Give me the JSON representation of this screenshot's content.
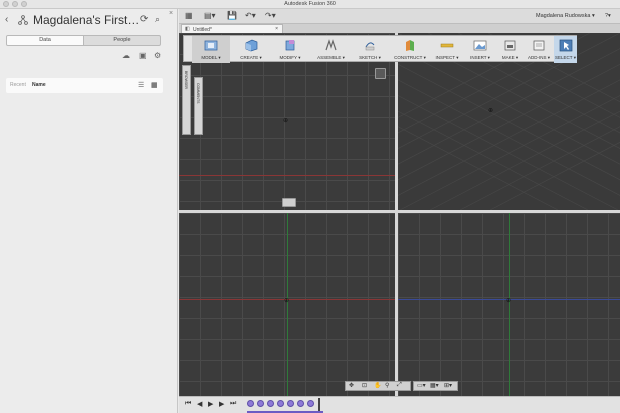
{
  "window": {
    "title": "Autodesk Fusion 360"
  },
  "data_panel": {
    "project_title": "Magdalena's First…",
    "tabs": [
      {
        "label": "Data",
        "active": true
      },
      {
        "label": "People",
        "active": false
      }
    ],
    "list_header": {
      "recent_label": "Recent",
      "name_label": "Name"
    }
  },
  "app_toolbar": {
    "user_name": "Magdalena Rudowska ▾",
    "help_label": "?▾"
  },
  "document_tab": {
    "label": "Untitled*",
    "close": "×"
  },
  "design_toolbar": {
    "tools": [
      {
        "label": "MODEL ▾",
        "icon": "model-workspace-icon"
      },
      {
        "label": "CREATE ▾",
        "icon": "create-box-icon"
      },
      {
        "label": "MODIFY ▾",
        "icon": "modify-icon"
      },
      {
        "label": "ASSEMBLE ▾",
        "icon": "assemble-icon"
      },
      {
        "label": "SKETCH ▾",
        "icon": "sketch-icon"
      },
      {
        "label": "CONSTRUCT ▾",
        "icon": "construct-plane-icon"
      },
      {
        "label": "INSPECT ▾",
        "icon": "inspect-icon"
      },
      {
        "label": "INSERT ▾",
        "icon": "insert-image-icon"
      },
      {
        "label": "MAKE ▾",
        "icon": "make-icon"
      },
      {
        "label": "ADD-INS ▾",
        "icon": "add-ins-icon"
      },
      {
        "label": "SELECT ▾",
        "icon": "select-cursor-icon"
      }
    ]
  },
  "side_tabs": {
    "browser": "BROWSER",
    "comments": "COMMENTS"
  },
  "colors": {
    "viewport_bg": "#3b3b3b",
    "axis_red": "#a33a3a",
    "axis_green": "#2f8a3a",
    "axis_blue": "#3a4fa8",
    "timeline_feature": "#8e7ad6"
  }
}
